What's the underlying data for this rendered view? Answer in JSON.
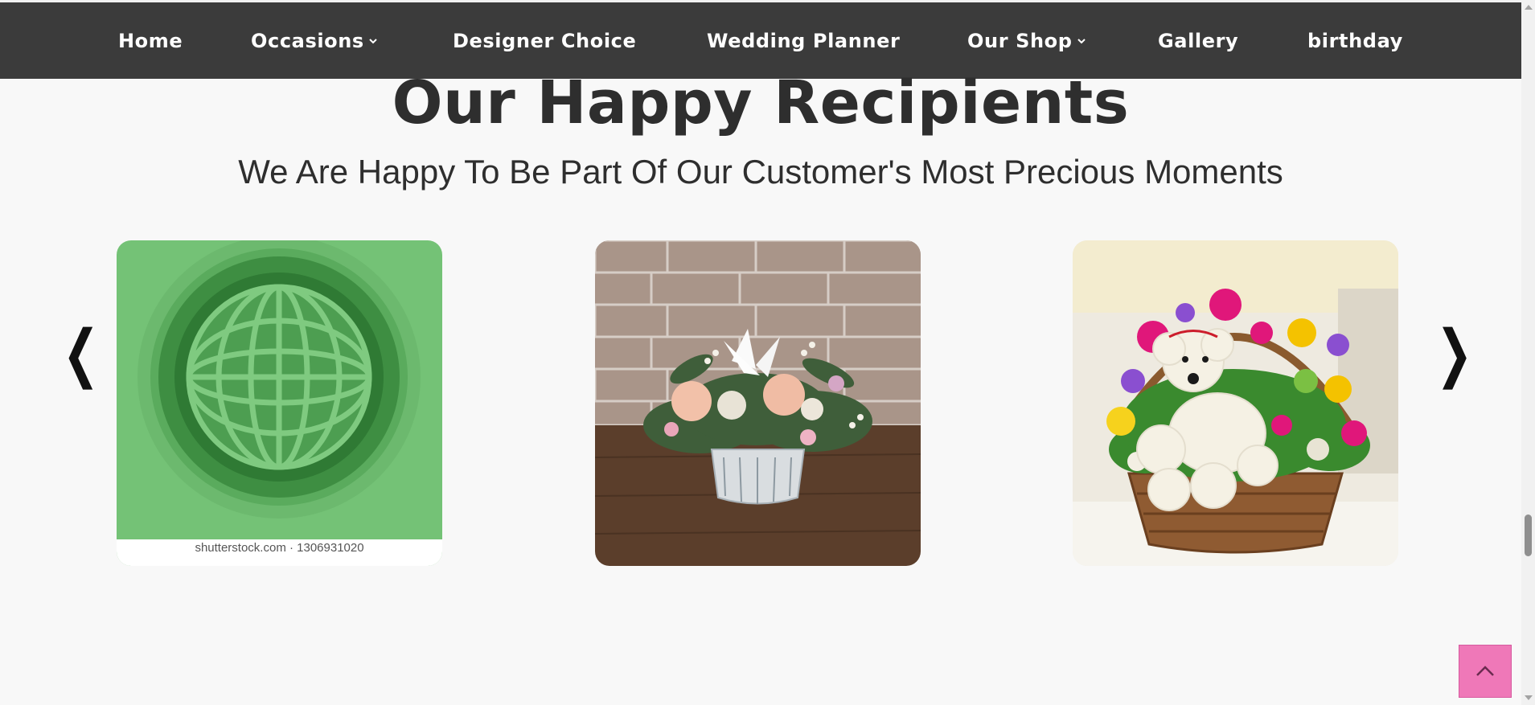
{
  "nav": {
    "items": [
      {
        "label": "Home",
        "has_dropdown": false
      },
      {
        "label": "Occasions",
        "has_dropdown": true
      },
      {
        "label": "Designer Choice",
        "has_dropdown": false
      },
      {
        "label": "Wedding Planner",
        "has_dropdown": false
      },
      {
        "label": "Our Shop",
        "has_dropdown": true
      },
      {
        "label": "Gallery",
        "has_dropdown": false
      },
      {
        "label": "birthday",
        "has_dropdown": false
      }
    ]
  },
  "section": {
    "title": "Our Happy Recipients",
    "subtitle": "We Are Happy To Be Part Of Our Customer's Most Precious Moments"
  },
  "carousel": {
    "prev_glyph": "❮",
    "next_glyph": "❯",
    "slides": [
      {
        "name": "globe-stock-image",
        "caption": "shutterstock.com · 1306931020"
      },
      {
        "name": "flower-arrangement-image"
      },
      {
        "name": "puppy-flower-basket-image"
      }
    ]
  },
  "back_to_top": {
    "icon": "chevron-up-icon"
  },
  "colors": {
    "navbar": "#3b3b3b",
    "accent": "#ef78b8",
    "text": "#2e2e2e",
    "background": "#f8f8f8"
  }
}
